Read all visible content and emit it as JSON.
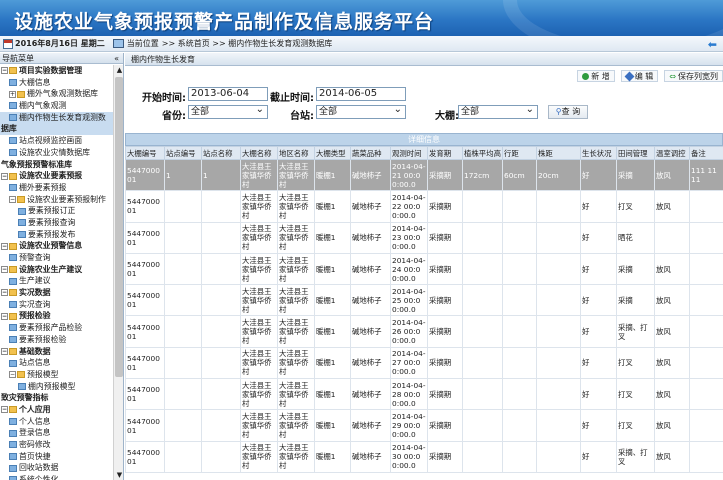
{
  "app": {
    "title": "设施农业气象预报预警产品制作及信息服务平台"
  },
  "crumb": {
    "date": "2016年8月16日 星期二",
    "location_label": "当前位置",
    "path": ">> 系统首页 >> 棚内作物生长发育观测数据库"
  },
  "sidebar": {
    "header": "导航菜单",
    "collapse": "«",
    "items": [
      {
        "label": "项目实验数据管理",
        "level": 0,
        "toggle": "−",
        "icon": "folder-icon"
      },
      {
        "label": "大棚信息",
        "level": 1,
        "icon": "leaf-icon"
      },
      {
        "label": "棚外气象观测数据库",
        "level": 1,
        "toggle": "+",
        "icon": "folder-icon"
      },
      {
        "label": "棚内气象观测",
        "level": 1,
        "icon": "leaf-icon"
      },
      {
        "label": "棚内作物生长发育观测数",
        "level": 1,
        "icon": "leaf-icon",
        "selected": true
      },
      {
        "label": "据库",
        "level": 0,
        "continuation": true,
        "selected": true
      },
      {
        "label": "站点视频监控画面",
        "level": 1,
        "icon": "leaf-icon"
      },
      {
        "label": "设施农业灾情数据库",
        "level": 1,
        "icon": "leaf-icon"
      },
      {
        "label": "气象预报预警标准库",
        "level": 0,
        "continuation": true
      },
      {
        "label": "设施农业要素预报",
        "level": 0,
        "toggle": "−",
        "icon": "folder-icon"
      },
      {
        "label": "棚外要素预报",
        "level": 1,
        "icon": "leaf-icon"
      },
      {
        "label": "设施农业要素预报制作",
        "level": 1,
        "toggle": "−",
        "icon": "folder-icon"
      },
      {
        "label": "要素预报订正",
        "level": 2,
        "icon": "leaf-icon"
      },
      {
        "label": "要素预报查询",
        "level": 2,
        "icon": "leaf-icon"
      },
      {
        "label": "要素预报发布",
        "level": 2,
        "icon": "leaf-icon"
      },
      {
        "label": "设施农业预警信息",
        "level": 0,
        "toggle": "−",
        "icon": "folder-icon"
      },
      {
        "label": "预警查询",
        "level": 1,
        "icon": "leaf-icon"
      },
      {
        "label": "设施农业生产建议",
        "level": 0,
        "toggle": "−",
        "icon": "folder-icon"
      },
      {
        "label": "生产建议",
        "level": 1,
        "icon": "leaf-icon"
      },
      {
        "label": "实况数据",
        "level": 0,
        "toggle": "−",
        "icon": "folder-icon"
      },
      {
        "label": "实况查询",
        "level": 1,
        "icon": "leaf-icon"
      },
      {
        "label": "预报检验",
        "level": 0,
        "toggle": "−",
        "icon": "folder-icon"
      },
      {
        "label": "要素预报产品检验",
        "level": 1,
        "icon": "leaf-icon"
      },
      {
        "label": "要素预报检验",
        "level": 1,
        "icon": "leaf-icon"
      },
      {
        "label": "基础数据",
        "level": 0,
        "toggle": "−",
        "icon": "folder-icon"
      },
      {
        "label": "站点信息",
        "level": 1,
        "icon": "leaf-icon"
      },
      {
        "label": "预报模型",
        "level": 1,
        "toggle": "−",
        "icon": "folder-icon"
      },
      {
        "label": "棚内预报模型",
        "level": 2,
        "icon": "leaf-icon"
      },
      {
        "label": "致灾预警指标",
        "level": 0,
        "continuation": true
      },
      {
        "label": "个人应用",
        "level": 0,
        "toggle": "−",
        "icon": "folder-icon"
      },
      {
        "label": "个人信息",
        "level": 1,
        "icon": "leaf-icon"
      },
      {
        "label": "登录信息",
        "level": 1,
        "icon": "leaf-icon"
      },
      {
        "label": "密码修改",
        "level": 1,
        "icon": "leaf-icon"
      },
      {
        "label": "首页快捷",
        "level": 1,
        "icon": "leaf-icon"
      },
      {
        "label": "回收站数据",
        "level": 1,
        "icon": "leaf-icon"
      },
      {
        "label": "系统个性化",
        "level": 1,
        "icon": "leaf-icon"
      }
    ]
  },
  "panel": {
    "title": "棚内作物生长发育"
  },
  "toolbar": {
    "add": "新 增",
    "edit": "编 辑",
    "save_columns": "保存列宽列"
  },
  "filters": {
    "start_label": "开始时间:",
    "start_value": "2013-06-04",
    "end_label": "截止时间:",
    "end_value": "2014-06-05",
    "province_label": "省份:",
    "province_value": "全部",
    "station_label": "台站:",
    "station_value": "全部",
    "greenhouse_label": "大棚:",
    "greenhouse_value": "全部",
    "query": "查 询"
  },
  "grid": {
    "caption": "详细信息",
    "columns": [
      "大棚编号",
      "站点编号",
      "站点名称",
      "大棚名称",
      "地区名称",
      "大棚类型",
      "蔬菜品种",
      "观测时间",
      "发育期",
      "植株平均高",
      "行距",
      "株距",
      "生长状况",
      "田间管理",
      "温室调控",
      "备注"
    ],
    "rows": [
      [
        "544700001",
        "1",
        "1",
        "大洼县王家镇华侨村",
        "大洼县王家镇华侨村",
        "暖棚1",
        "碱地柿子",
        "2014-04-21 00:00:00.0",
        "采摘期",
        "172cm",
        "60cm",
        "20cm",
        "好",
        "采摘",
        "放风",
        "111 11 11"
      ],
      [
        "544700001",
        "",
        "",
        "大洼县王家镇华侨村",
        "大洼县王家镇华侨村",
        "暖棚1",
        "碱地柿子",
        "2014-04-22 00:00:00.0",
        "采摘期",
        "",
        "",
        "",
        "好",
        "打叉",
        "放风",
        ""
      ],
      [
        "544700001",
        "",
        "",
        "大洼县王家镇华侨村",
        "大洼县王家镇华侨村",
        "暖棚1",
        "碱地柿子",
        "2014-04-23 00:00:00.0",
        "采摘期",
        "",
        "",
        "",
        "好",
        "晒花",
        "",
        ""
      ],
      [
        "544700001",
        "",
        "",
        "大洼县王家镇华侨村",
        "大洼县王家镇华侨村",
        "暖棚1",
        "碱地柿子",
        "2014-04-24 00:00:00.0",
        "采摘期",
        "",
        "",
        "",
        "好",
        "采摘",
        "放风",
        ""
      ],
      [
        "544700001",
        "",
        "",
        "大洼县王家镇华侨村",
        "大洼县王家镇华侨村",
        "暖棚1",
        "碱地柿子",
        "2014-04-25 00:00:00.0",
        "采摘期",
        "",
        "",
        "",
        "好",
        "采摘",
        "放风",
        ""
      ],
      [
        "544700001",
        "",
        "",
        "大洼县王家镇华侨村",
        "大洼县王家镇华侨村",
        "暖棚1",
        "碱地柿子",
        "2014-04-26 00:00:00.0",
        "采摘期",
        "",
        "",
        "",
        "好",
        "采摘、打叉",
        "放风",
        ""
      ],
      [
        "544700001",
        "",
        "",
        "大洼县王家镇华侨村",
        "大洼县王家镇华侨村",
        "暖棚1",
        "碱地柿子",
        "2014-04-27 00:00:00.0",
        "采摘期",
        "",
        "",
        "",
        "好",
        "打叉",
        "放风",
        ""
      ],
      [
        "544700001",
        "",
        "",
        "大洼县王家镇华侨村",
        "大洼县王家镇华侨村",
        "暖棚1",
        "碱地柿子",
        "2014-04-28 00:00:00.0",
        "采摘期",
        "",
        "",
        "",
        "好",
        "打叉",
        "放风",
        ""
      ],
      [
        "544700001",
        "",
        "",
        "大洼县王家镇华侨村",
        "大洼县王家镇华侨村",
        "暖棚1",
        "碱地柿子",
        "2014-04-29 00:00:00.0",
        "采摘期",
        "",
        "",
        "",
        "好",
        "打叉",
        "放风",
        ""
      ],
      [
        "544700001",
        "",
        "",
        "大洼县王家镇华侨村",
        "大洼县王家镇华侨村",
        "暖棚1",
        "碱地柿子",
        "2014-04-30 00:00:00.0",
        "采摘期",
        "",
        "",
        "",
        "好",
        "采摘、打叉",
        "放风",
        ""
      ]
    ]
  }
}
